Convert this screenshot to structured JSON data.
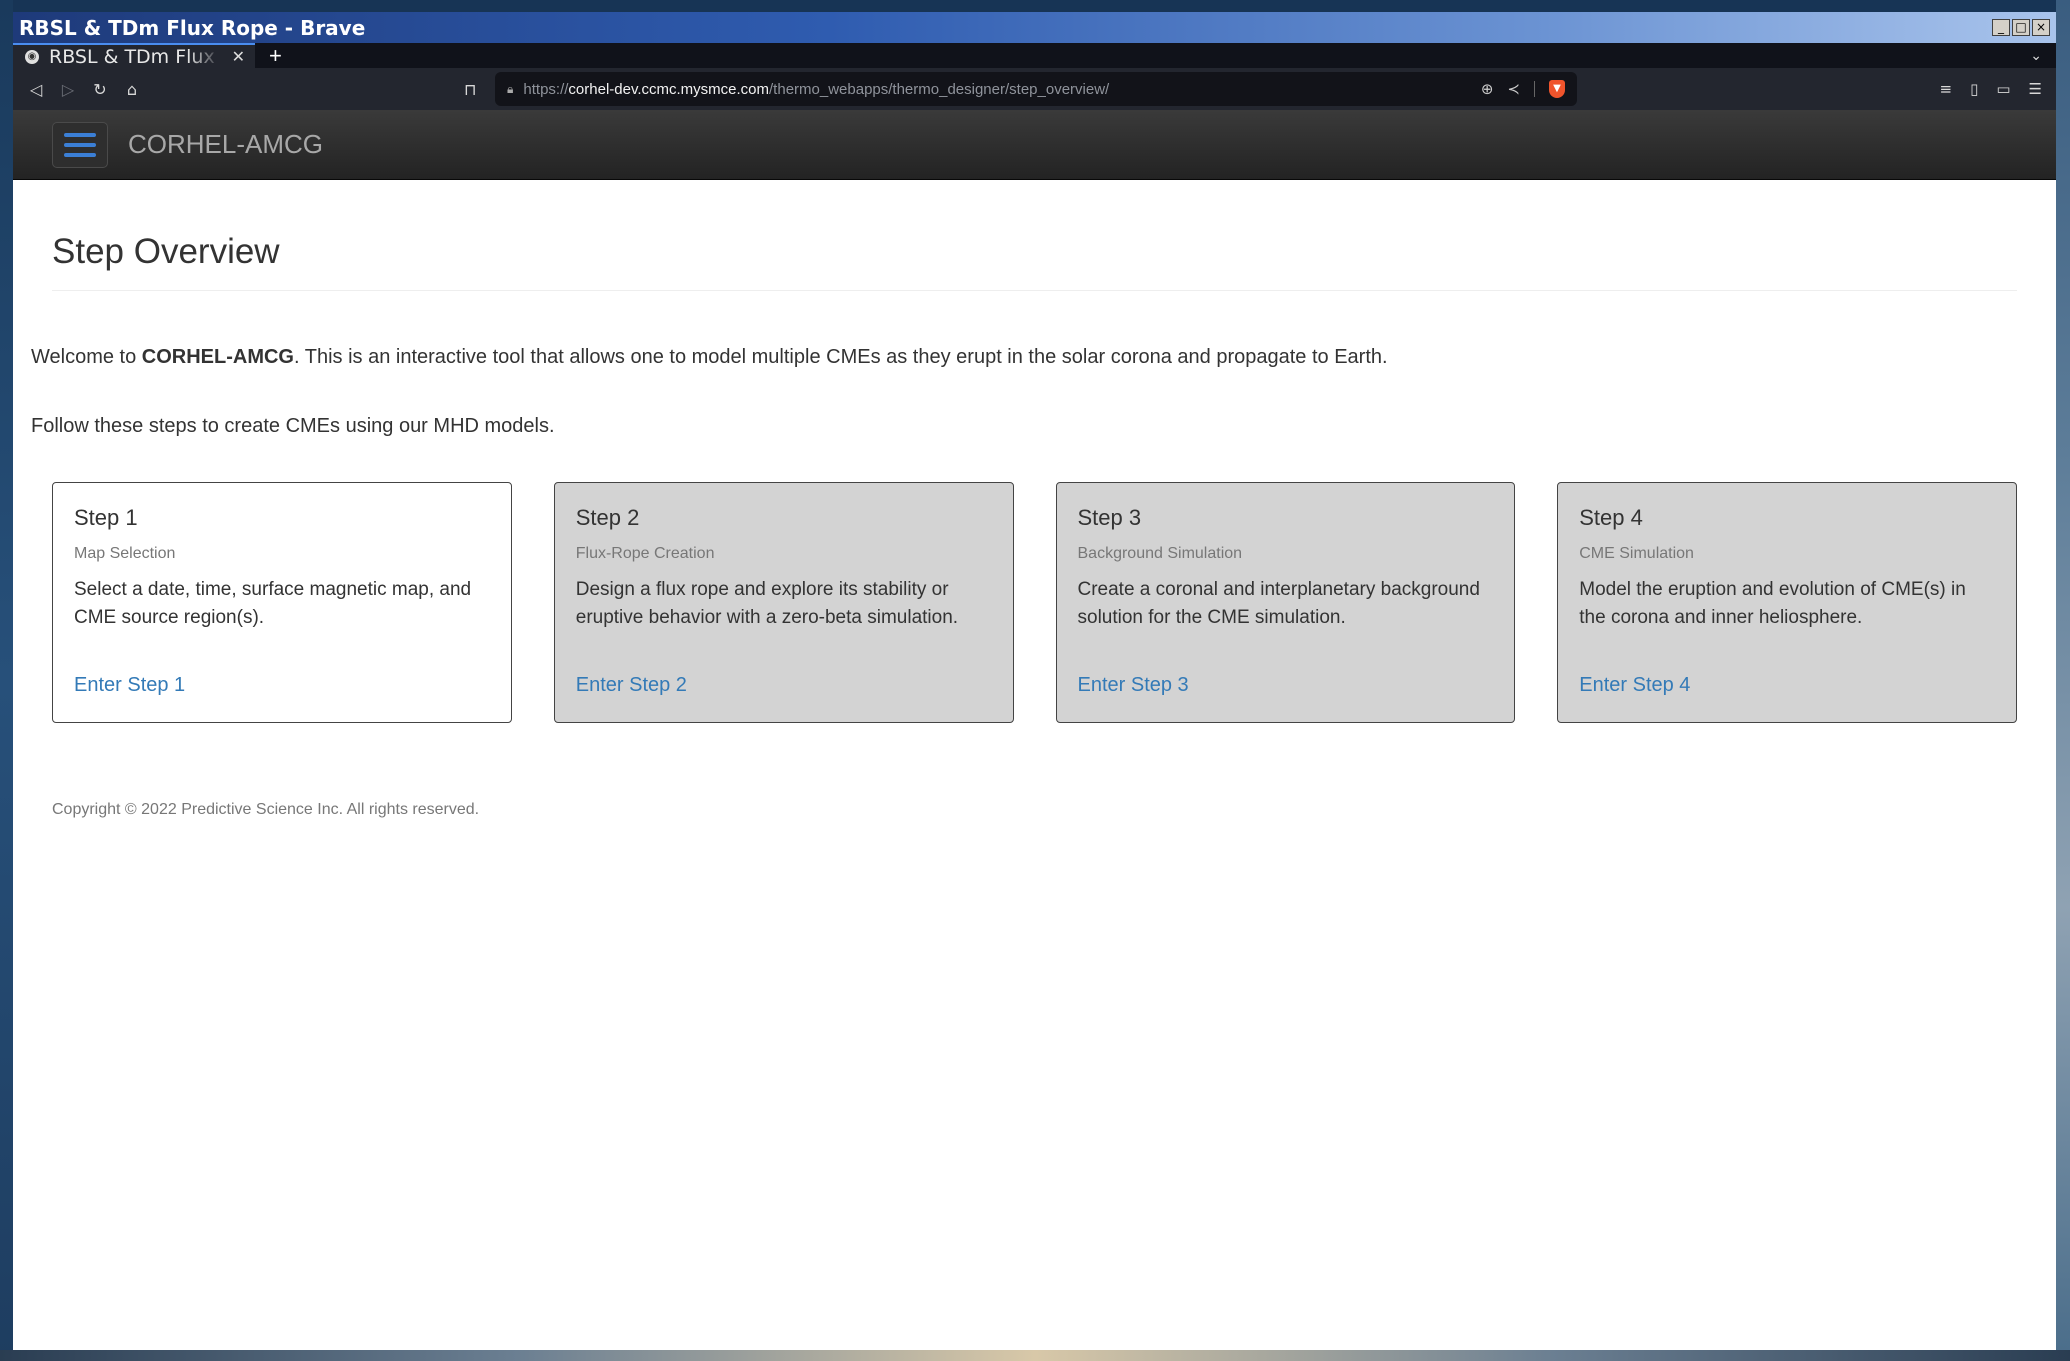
{
  "window": {
    "title": "RBSL & TDm Flux Rope - Brave"
  },
  "browser": {
    "tab_title": "RBSL & TDm Flux Rope",
    "url_prefix": "https://",
    "url_host": "corhel-dev.ccmc.mysmce.com",
    "url_path": "/thermo_webapps/thermo_designer/step_overview/"
  },
  "navbar": {
    "brand": "CORHEL-AMCG"
  },
  "page": {
    "title": "Step Overview",
    "intro_before": "Welcome to ",
    "intro_bold": "CORHEL-AMCG",
    "intro_after": ". This is an interactive tool that allows one to model multiple CMEs as they erupt in the solar corona and propagate to Earth.",
    "follow_text": "Follow these steps to create CMEs using our MHD models."
  },
  "steps": [
    {
      "title": "Step 1",
      "subtitle": "Map Selection",
      "text": "Select a date, time, surface magnetic map, and CME source region(s).",
      "link": "Enter Step 1"
    },
    {
      "title": "Step 2",
      "subtitle": "Flux-Rope Creation",
      "text": "Design a flux rope and explore its stability or eruptive behavior with a zero-beta simulation.",
      "link": "Enter Step 2"
    },
    {
      "title": "Step 3",
      "subtitle": "Background Simulation",
      "text": "Create a coronal and interplanetary background solution for the CME simulation.",
      "link": "Enter Step 3"
    },
    {
      "title": "Step 4",
      "subtitle": "CME Simulation",
      "text": "Model the eruption and evolution of CME(s) in the corona and inner heliosphere.",
      "link": "Enter Step 4"
    }
  ],
  "footer": {
    "copyright": "Copyright © 2022 Predictive Science Inc. All rights reserved."
  },
  "colors": {
    "link": "#337ab7",
    "hamburger": "#3b7fd6",
    "inactive_card": "#d3d3d3"
  }
}
